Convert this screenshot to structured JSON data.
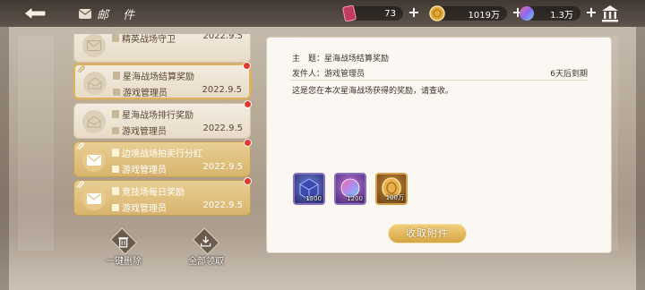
{
  "header": {
    "title": "邮 件",
    "resources": [
      {
        "icon": "gem-ticket-icon",
        "value": "73"
      },
      {
        "icon": "gold-coin-icon",
        "value": "1019万"
      },
      {
        "icon": "rainbow-orb-icon",
        "value": "1.3万"
      }
    ]
  },
  "mails": [
    {
      "title": "精英战场守卫",
      "sender": "",
      "date": "2022.9.5",
      "state": "read"
    },
    {
      "title": "星海战场结算奖励",
      "sender": "游戏管理员",
      "date": "2022.9.5",
      "state": "read"
    },
    {
      "title": "星海战场排行奖励",
      "sender": "游戏管理员",
      "date": "2022.9.5",
      "state": "read"
    },
    {
      "title": "边境战场拍卖行分红",
      "sender": "游戏管理员",
      "date": "2022.9.5",
      "state": "unread"
    },
    {
      "title": "竞技场每日奖励",
      "sender": "游戏管理员",
      "date": "2022.9.5",
      "state": "unread"
    }
  ],
  "actions": {
    "delete_label": "一键删除",
    "claim_all_label": "全部领取"
  },
  "detail": {
    "subject_label": "主　题：",
    "subject": "星海战场结算奖励",
    "sender_label": "发件人：",
    "sender": "游戏管理员",
    "expire": "6天后到期",
    "body": "这是您在本次星海战场获得的奖励，请查收。",
    "attachments": [
      {
        "icon": "crystal-cube-icon",
        "qty": "1500"
      },
      {
        "icon": "rainbow-orb-icon",
        "qty": "1200"
      },
      {
        "icon": "gold-coin-icon",
        "qty": "100万"
      }
    ],
    "claim_label": "收取附件"
  }
}
